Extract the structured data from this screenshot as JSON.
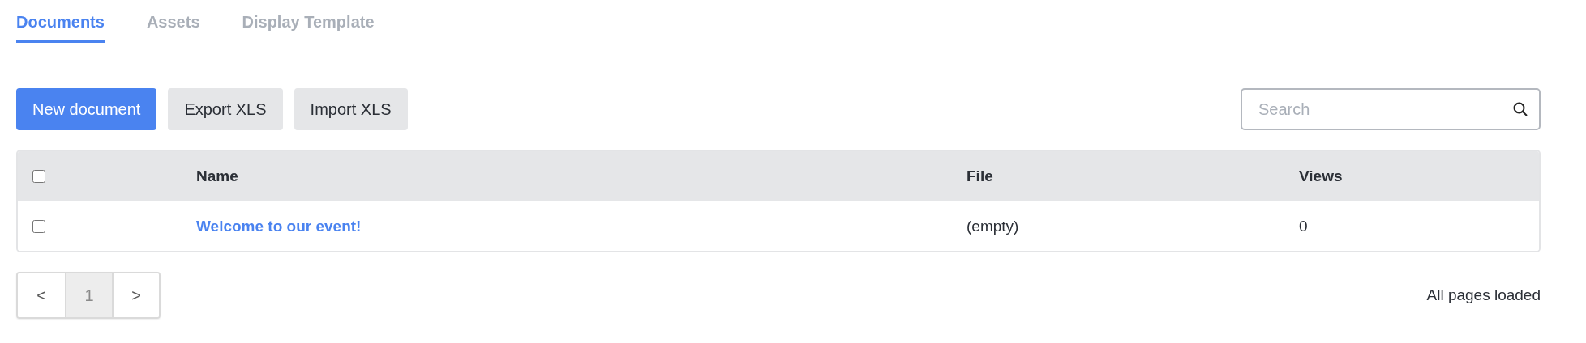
{
  "tabs": [
    {
      "label": "Documents",
      "selected": true
    },
    {
      "label": "Assets",
      "selected": false
    },
    {
      "label": "Display Template",
      "selected": false
    }
  ],
  "toolbar": {
    "buttons": [
      {
        "label": "New document",
        "kind": "primary"
      },
      {
        "label": "Export XLS",
        "kind": "secondary"
      },
      {
        "label": "Import XLS",
        "kind": "secondary"
      }
    ],
    "search": {
      "placeholder": "Search"
    }
  },
  "table": {
    "header_checked": false,
    "columns": [
      "Name",
      "File",
      "Views"
    ],
    "rows": [
      {
        "checked": false,
        "cells": [
          "Welcome to our event!",
          "(empty)",
          "0"
        ]
      }
    ]
  },
  "pagination": {
    "prev": "<",
    "pages": [
      {
        "label": "1",
        "selected": true
      }
    ],
    "next": ">"
  },
  "status": "All pages loaded"
}
